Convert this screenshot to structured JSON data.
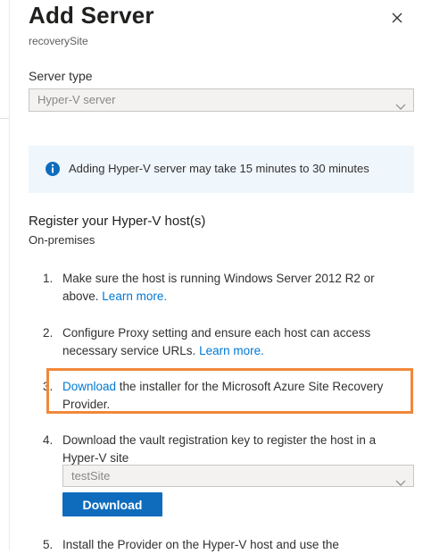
{
  "panel": {
    "title": "Add Server",
    "subtitle": "recoverySite"
  },
  "server_type": {
    "label": "Server type",
    "value": "Hyper-V server"
  },
  "info": {
    "text": "Adding Hyper-V server may take 15 minutes to 30 minutes"
  },
  "register": {
    "heading": "Register your Hyper-V host(s)",
    "subheading": "On-premises"
  },
  "steps": [
    {
      "num": "1.",
      "pre": "Make sure the host is running Windows Server 2012 R2 or above. ",
      "link": "Learn more.",
      "post": ""
    },
    {
      "num": "2.",
      "pre": "Configure Proxy setting and ensure each host can access necessary service URLs. ",
      "link": "Learn more.",
      "post": ""
    },
    {
      "num": "3.",
      "pre": "",
      "link": "Download",
      "post": " the installer for the Microsoft Azure Site Recovery Provider."
    },
    {
      "num": "4.",
      "pre": "Download the vault registration key to register the host in a Hyper-V site",
      "link": "",
      "post": ""
    },
    {
      "num": "5.",
      "pre": "Install the Provider on the Hyper-V host and use the",
      "link": "",
      "post": ""
    }
  ],
  "site_select": {
    "value": "testSite"
  },
  "download_button": "Download",
  "colors": {
    "accent": "#0078d4",
    "button": "#0f6cbd",
    "highlight": "#f0883a",
    "info_bg": "#eff6fc"
  }
}
